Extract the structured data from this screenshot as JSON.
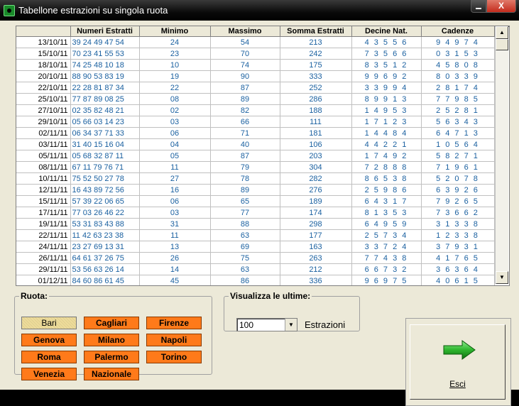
{
  "window": {
    "title": "Tabellone estrazioni su singola ruota",
    "close_label": "X"
  },
  "grid": {
    "headers": [
      "",
      "Numeri Estratti",
      "Minimo",
      "Massimo",
      "Somma Estratti",
      "Decine Nat.",
      "Cadenze"
    ],
    "rows": [
      [
        "13/10/11",
        "39 24 49 47 54",
        "24",
        "54",
        "213",
        "4 3 5 5 6",
        "9 4 9 7 4"
      ],
      [
        "15/10/11",
        "70 23 41 55 53",
        "23",
        "70",
        "242",
        "7 3 5 6 6",
        "0 3 1 5 3"
      ],
      [
        "18/10/11",
        "74 25 48 10 18",
        "10",
        "74",
        "175",
        "8 3 5 1 2",
        "4 5 8 0 8"
      ],
      [
        "20/10/11",
        "88 90 53 83 19",
        "19",
        "90",
        "333",
        "9 9 6 9 2",
        "8 0 3 3 9"
      ],
      [
        "22/10/11",
        "22 28 81 87 34",
        "22",
        "87",
        "252",
        "3 3 9 9 4",
        "2 8 1 7 4"
      ],
      [
        "25/10/11",
        "77 87 89 08 25",
        "08",
        "89",
        "286",
        "8 9 9 1 3",
        "7 7 9 8 5"
      ],
      [
        "27/10/11",
        "02 35 82 48 21",
        "02",
        "82",
        "188",
        "1 4 9 5 3",
        "2 5 2 8 1"
      ],
      [
        "29/10/11",
        "05 66 03 14 23",
        "03",
        "66",
        "111",
        "1 7 1 2 3",
        "5 6 3 4 3"
      ],
      [
        "02/11/11",
        "06 34 37 71 33",
        "06",
        "71",
        "181",
        "1 4 4 8 4",
        "6 4 7 1 3"
      ],
      [
        "03/11/11",
        "31 40 15 16 04",
        "04",
        "40",
        "106",
        "4 4 2 2 1",
        "1 0 5 6 4"
      ],
      [
        "05/11/11",
        "05 68 32 87 11",
        "05",
        "87",
        "203",
        "1 7 4 9 2",
        "5 8 2 7 1"
      ],
      [
        "08/11/11",
        "67 11 79 76 71",
        "11",
        "79",
        "304",
        "7 2 8 8 8",
        "7 1 9 6 1"
      ],
      [
        "10/11/11",
        "75 52 50 27 78",
        "27",
        "78",
        "282",
        "8 6 5 3 8",
        "5 2 0 7 8"
      ],
      [
        "12/11/11",
        "16 43 89 72 56",
        "16",
        "89",
        "276",
        "2 5 9 8 6",
        "6 3 9 2 6"
      ],
      [
        "15/11/11",
        "57 39 22 06 65",
        "06",
        "65",
        "189",
        "6 4 3 1 7",
        "7 9 2 6 5"
      ],
      [
        "17/11/11",
        "77 03 26 46 22",
        "03",
        "77",
        "174",
        "8 1 3 5 3",
        "7 3 6 6 2"
      ],
      [
        "19/11/11",
        "53 31 83 43 88",
        "31",
        "88",
        "298",
        "6 4 9 5 9",
        "3 1 3 3 8"
      ],
      [
        "22/11/11",
        "11 42 63 23 38",
        "11",
        "63",
        "177",
        "2 5 7 3 4",
        "1 2 3 3 8"
      ],
      [
        "24/11/11",
        "23 27 69 13 31",
        "13",
        "69",
        "163",
        "3 3 7 2 4",
        "3 7 9 3 1"
      ],
      [
        "26/11/11",
        "64 61 37 26 75",
        "26",
        "75",
        "263",
        "7 7 4 3 8",
        "4 1 7 6 5"
      ],
      [
        "29/11/11",
        "53 56 63 26 14",
        "14",
        "63",
        "212",
        "6 6 7 3 2",
        "3 6 3 6 4"
      ],
      [
        "01/12/11",
        "84 60 86 61 45",
        "45",
        "86",
        "336",
        "9 6 9 7 5",
        "4 0 6 1 5"
      ]
    ]
  },
  "ruota": {
    "legend": "Ruota:",
    "buttons": [
      {
        "label": "Bari",
        "selected": true
      },
      {
        "label": "Cagliari"
      },
      {
        "label": "Firenze"
      },
      {
        "label": "Genova"
      },
      {
        "label": "Milano"
      },
      {
        "label": "Napoli"
      },
      {
        "label": "Roma"
      },
      {
        "label": "Palermo"
      },
      {
        "label": "Torino"
      },
      {
        "label": "Venezia"
      },
      {
        "label": "Nazionale"
      }
    ]
  },
  "visualizza": {
    "legend": "Visualizza le ultime:",
    "value": "100",
    "suffix": "Estrazioni"
  },
  "exit": {
    "label": "Esci"
  },
  "colors": {
    "ruota_button": "#ff7a1a",
    "selected_button": "#eedc9a",
    "data_text": "#1a60a0",
    "exit_arrow": "#2db52d"
  }
}
